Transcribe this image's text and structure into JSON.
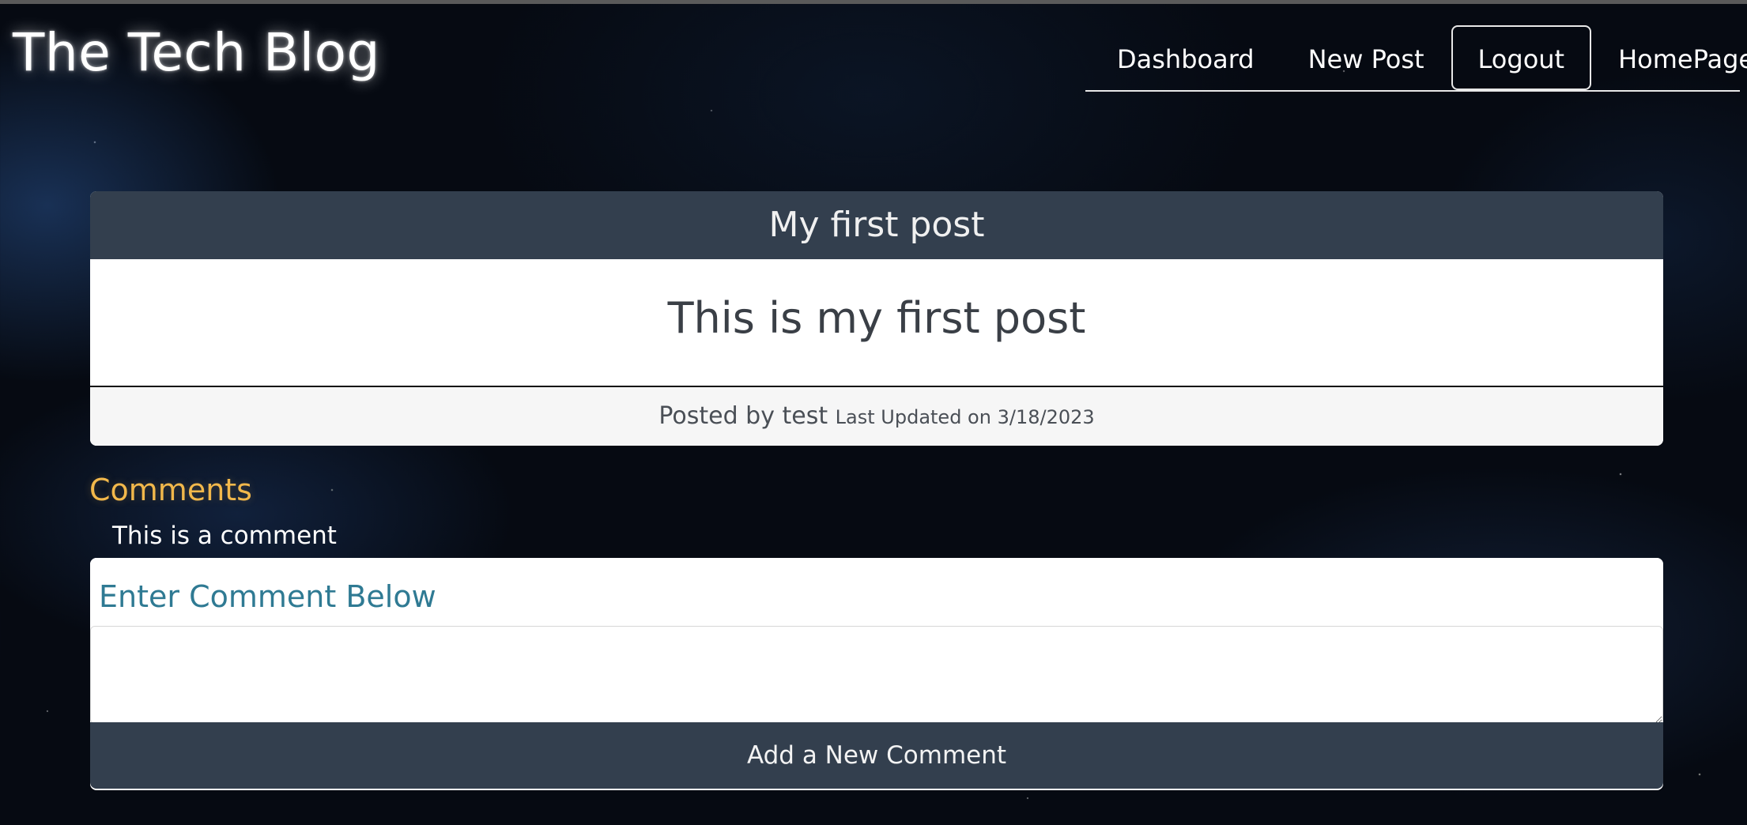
{
  "header": {
    "site_title": "The Tech Blog",
    "nav": [
      {
        "label": "Dashboard",
        "active": false
      },
      {
        "label": "New Post",
        "active": false
      },
      {
        "label": "Logout",
        "active": true
      },
      {
        "label": "HomePage",
        "active": false
      }
    ]
  },
  "post": {
    "title": "My first post",
    "content": "This is my first post",
    "posted_by": "Posted by test",
    "last_updated": "Last Updated on 3/18/2023"
  },
  "comments": {
    "heading": "Comments",
    "items": [
      "This is a comment"
    ]
  },
  "comment_form": {
    "label": "Enter Comment Below",
    "input_value": "",
    "submit_label": "Add a New Comment"
  },
  "colors": {
    "card_header": "#333f4e",
    "comments_heading": "#f2b84b",
    "form_label": "#2f7a93"
  }
}
